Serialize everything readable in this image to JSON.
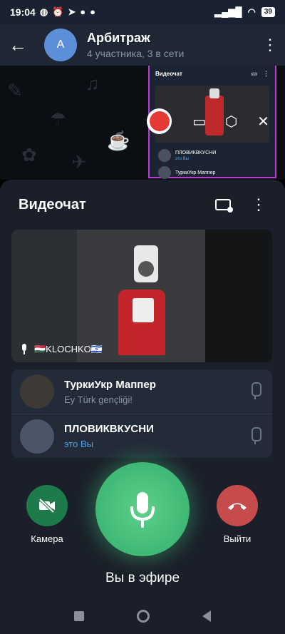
{
  "status_bar": {
    "time": "19:04",
    "battery": "39"
  },
  "chat": {
    "avatar_letter": "A",
    "title": "Арбитраж",
    "subtitle": "4 участника, 3 в сети"
  },
  "pip": {
    "title": "Видеочат",
    "participants": [
      {
        "name": "ПЛОВИКВКУСНИ",
        "status": "это Вы"
      },
      {
        "name": "ТуркиУкр Маппер"
      }
    ]
  },
  "sheet": {
    "title": "Видеочат",
    "video_label": "🇭🇺KLOCHKO🇮🇱",
    "participants": [
      {
        "name": "ТуркиУкр Маппер",
        "status": "Ey Türk gençliği!",
        "is_me": false
      },
      {
        "name": "ПЛОВИКВКУСНИ",
        "status": "это Вы",
        "is_me": true
      }
    ]
  },
  "controls": {
    "camera_label": "Камера",
    "leave_label": "Выйти",
    "status_text": "Вы в эфире"
  },
  "colors": {
    "accent_blue": "#4aa3ec",
    "mic_green": "#3fb875",
    "camera_green": "#1d7a4a",
    "leave_red": "#c64b4b",
    "record_red": "#e53935"
  }
}
